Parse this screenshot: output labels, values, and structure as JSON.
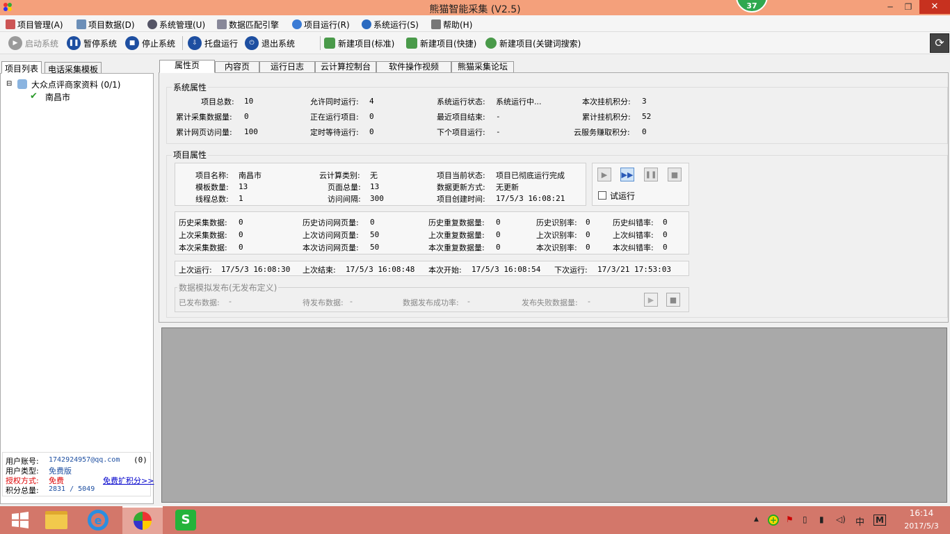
{
  "window": {
    "title": "熊猫智能采集  (V2.5)",
    "badge": "37"
  },
  "menu": [
    "项目管理(A)",
    "项目数据(D)",
    "系统管理(U)",
    "数据匹配引擎",
    "项目运行(R)",
    "系统运行(S)",
    "帮助(H)"
  ],
  "toolbar": {
    "start": "启动系统",
    "pause": "暂停系统",
    "stop": "停止系统",
    "tray": "托盘运行",
    "exit": "退出系统",
    "new_std": "新建项目(标准)",
    "new_fast": "新建项目(快捷)",
    "new_kw": "新建项目(关键词搜索)"
  },
  "left": {
    "tab1": "项目列表",
    "tab2": "电话采集模板",
    "tree_root": "大众点评商家资料 (0/1)",
    "tree_child": "南昌市",
    "acct_label": "用户账号:",
    "acct": "1742924957@qq.com",
    "acct_count": "(0)",
    "type_label": "用户类型:",
    "type": "免费版",
    "auth_label": "授权方式:",
    "auth": "免费",
    "expand": "免费扩积分>>",
    "score_label": "积分总量:",
    "score": "2831 / 5049"
  },
  "tabs": [
    "属性页",
    "内容页",
    "运行日志",
    "云计算控制台",
    "软件操作视频",
    "熊猫采集论坛"
  ],
  "sys": {
    "title": "系统属性",
    "r1": [
      "项目总数:",
      "10",
      "允许同时运行:",
      "4",
      "系统运行状态:",
      "系统运行中...",
      "本次挂机积分:",
      "3"
    ],
    "r2": [
      "累计采集数据量:",
      "0",
      "正在运行项目:",
      "0",
      "最近项目结束:",
      "-",
      "累计挂机积分:",
      "52"
    ],
    "r3": [
      "累计网页访问量:",
      "100",
      "定时等待运行:",
      "0",
      "下个项目运行:",
      "-",
      "云服务赚取积分:",
      "0"
    ]
  },
  "proj": {
    "title": "项目属性",
    "a1": [
      "项目名称:",
      "南昌市",
      "云计算类别:",
      "无",
      "项目当前状态:",
      "项目已彻底运行完成"
    ],
    "a2": [
      "模板数量:",
      "13",
      "页面总量:",
      "13",
      "数据更新方式:",
      "无更新"
    ],
    "a3": [
      "线程总数:",
      "1",
      "访问间隔:",
      "300",
      "项目创建时间:",
      "17/5/3 16:08:21"
    ],
    "trial": "试运行",
    "b1": [
      "历史采集数据:",
      "0",
      "历史访问网页量:",
      "0",
      "历史重复数据量:",
      "0",
      "历史识别率:",
      "0",
      "历史纠错率:",
      "0"
    ],
    "b2": [
      "上次采集数据:",
      "0",
      "上次访问网页量:",
      "50",
      "上次重复数据量:",
      "0",
      "上次识别率:",
      "0",
      "上次纠错率:",
      "0"
    ],
    "b3": [
      "本次采集数据:",
      "0",
      "本次访问网页量:",
      "50",
      "本次重复数据量:",
      "0",
      "本次识别率:",
      "0",
      "本次纠错率:",
      "0"
    ],
    "c": [
      "上次运行:",
      "17/5/3 16:08:30",
      "上次结束:",
      "17/5/3 16:08:48",
      "本次开始:",
      "17/5/3 16:08:54",
      "下次运行:",
      "17/3/21 17:53:03"
    ],
    "pub_title": "数据模拟发布(无发布定义)",
    "pub": [
      "已发布数据:",
      "-",
      "待发布数据:",
      "-",
      "数据发布成功率:",
      "-",
      "发布失败数据量:",
      "-"
    ]
  },
  "taskbar": {
    "time": "16:14",
    "date": "2017/5/3",
    "ime": "中",
    "m": "M"
  }
}
